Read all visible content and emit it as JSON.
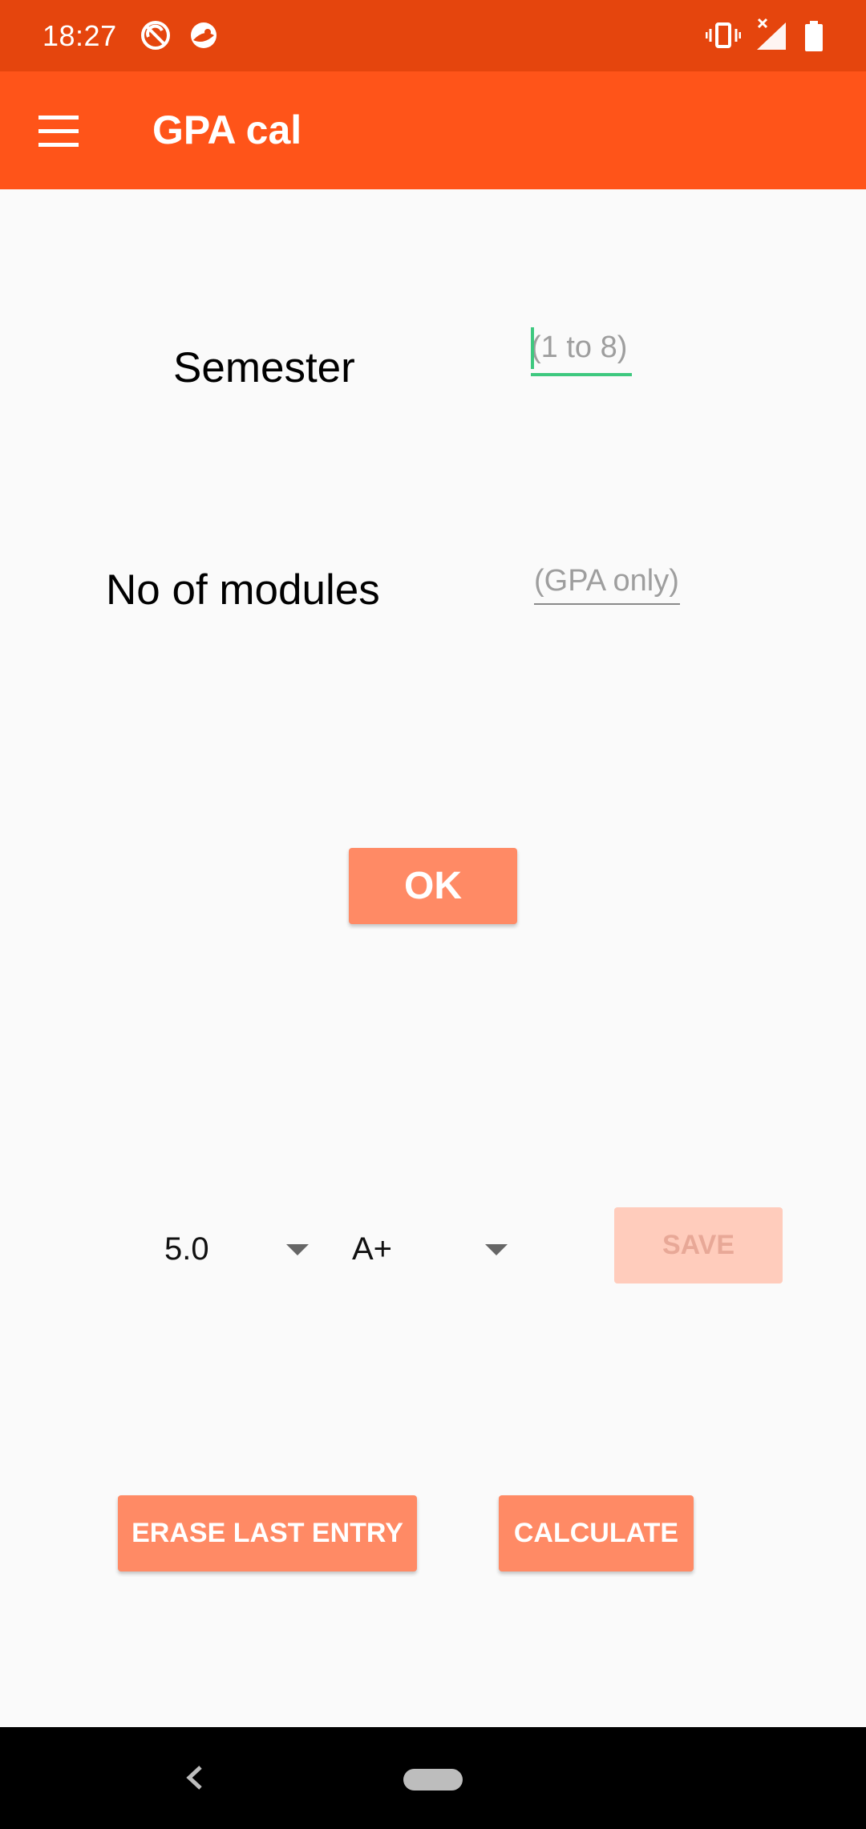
{
  "status_bar": {
    "time": "18:27",
    "left_icons": [
      "do-not-disturb-icon",
      "app-notification-icon"
    ],
    "right_icons": [
      "vibrate-icon",
      "signal-no-data-icon",
      "battery-icon"
    ]
  },
  "app_bar": {
    "title": "GPA cal",
    "menu_icon": "hamburger-menu-icon",
    "color": "#ff5419"
  },
  "form": {
    "semester_label": "Semester",
    "semester_placeholder": "(1 to 8)",
    "modules_label": "No of modules",
    "modules_placeholder": "(GPA only)",
    "ok_label": "OK"
  },
  "entry": {
    "credit_value": "5.0",
    "grade_value": "A+",
    "save_label": "SAVE",
    "save_enabled": false
  },
  "actions": {
    "erase_label": "ERASE LAST ENTRY",
    "calculate_label": "CALCULATE"
  },
  "colors": {
    "status_bar": "#e5450d",
    "accent_button": "#ff8a65",
    "disabled_button": "#ffccbc",
    "focus_underline": "#3ec87f"
  }
}
